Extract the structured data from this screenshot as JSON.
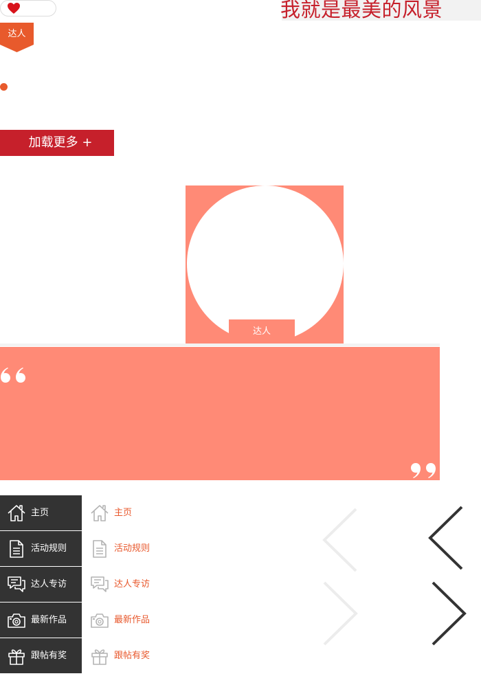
{
  "header": {
    "title": "我就是最美的风景",
    "heart_icon": "heart-icon"
  },
  "tag": {
    "label": "达人",
    "color": "#e85a2c"
  },
  "load_more": {
    "label": "加载更多 +",
    "color": "#c6202b"
  },
  "avatar": {
    "label": "达人",
    "bg": "#ff8a76"
  },
  "quote": {
    "open_icon": "open-quote-icon",
    "close_icon": "close-quote-icon",
    "bg": "#ff8a76"
  },
  "nav_dark": {
    "items": [
      {
        "label": "主页",
        "icon": "home-icon"
      },
      {
        "label": "活动规则",
        "icon": "document-icon"
      },
      {
        "label": "达人专访",
        "icon": "chat-icon"
      },
      {
        "label": "最新作品",
        "icon": "camera-icon"
      },
      {
        "label": "跟帖有奖",
        "icon": "gift-icon"
      }
    ]
  },
  "nav_light": {
    "items": [
      {
        "label": "主页",
        "icon": "home-icon"
      },
      {
        "label": "活动规则",
        "icon": "document-icon"
      },
      {
        "label": "达人专访",
        "icon": "chat-icon"
      },
      {
        "label": "最新作品",
        "icon": "camera-icon"
      },
      {
        "label": "跟帖有奖",
        "icon": "gift-icon"
      }
    ]
  },
  "arrows": {
    "prev_light": "chevron-left-icon",
    "prev_dark": "chevron-left-icon",
    "next_light": "chevron-right-icon",
    "next_dark": "chevron-right-icon"
  },
  "colors": {
    "accent_red": "#c6202b",
    "accent_orange": "#e85a2c",
    "salmon": "#ff8a76",
    "dark_nav": "#333333"
  }
}
